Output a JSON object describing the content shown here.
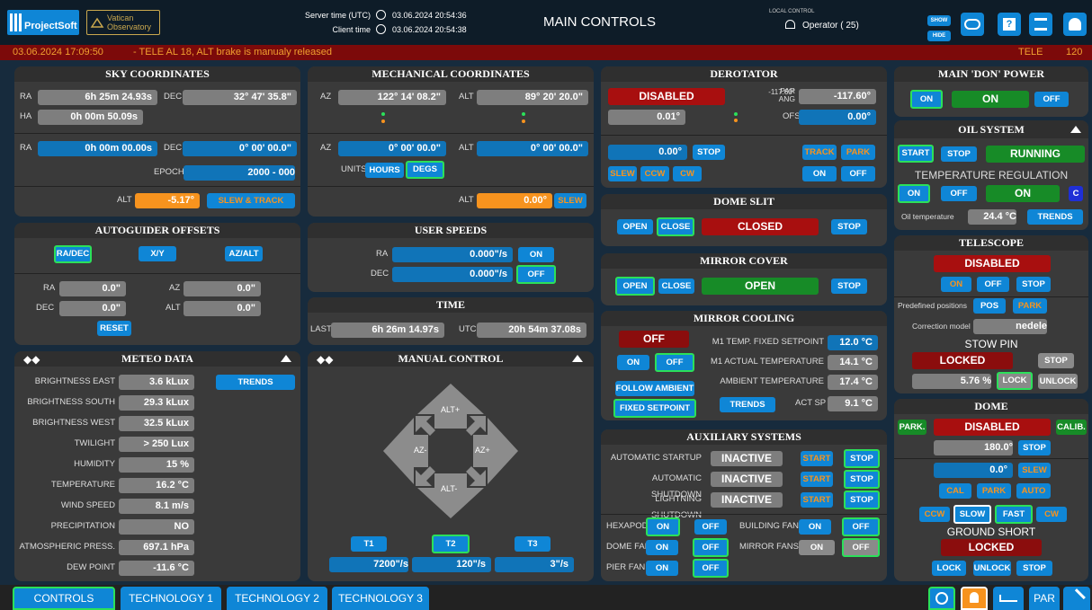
{
  "header": {
    "logo": "ProjectSoft",
    "observatory": "Vatican\nObservatory",
    "server_label": "Server time (UTC)",
    "server_time": "03.06.2024 20:54:36",
    "client_label": "Client time",
    "client_time": "03.06.2024 20:54:38",
    "title": "MAIN CONTROLS",
    "local_control": "LOCAL CONTROL",
    "operator": "Operator ( 25)",
    "show": "SHOW",
    "hide": "HIDE"
  },
  "alarm": {
    "time": "03.06.2024 17:09:50",
    "message": "-  TELE AL 18, ALT brake is manualy released",
    "source": "TELE",
    "code": "120"
  },
  "sky": {
    "title": "SKY COORDINATES",
    "ra_label": "RA",
    "ra": "6h  25m  24.93s",
    "dec_label": "DEC",
    "dec": "32°  47'  35.8\"",
    "ha_label": "HA",
    "ha": "0h  00m  50.09s",
    "ra2": "0h  00m  00.00s",
    "dec2": "0°  00'  00.0\"",
    "epoch_label": "EPOCH",
    "epoch": "2000 - 000",
    "alt_label": "ALT",
    "alt": "-5.17°",
    "slew_track": "SLEW & TRACK"
  },
  "mech": {
    "title": "MECHANICAL COORDINATES",
    "az_label": "AZ",
    "az": "122°  14'  08.2\"",
    "alt_label": "ALT",
    "alt": "89°  20'  20.0\"",
    "az2": "0°  00'  00.0\"",
    "alt2": "0°  00'  00.0\"",
    "units_label": "UNITS",
    "hours": "HOURS",
    "degs": "DEGS",
    "alt3": "0.00°",
    "slew": "SLEW"
  },
  "derotator": {
    "title": "DEROTATOR",
    "status": "DISABLED",
    "par_ang_label": "PAR\nANG",
    "par_ang": "-117.60°",
    "value": "0.01°",
    "ofs_label": "OFS",
    "ofs": "0.00°",
    "target": "0.00°",
    "stop": "STOP",
    "track": "TRACK",
    "park": "PARK",
    "slew": "SLEW",
    "ccw": "CCW",
    "cw": "CW",
    "on": "ON",
    "off": "OFF"
  },
  "don_power": {
    "title": "MAIN 'DON' POWER",
    "on": "ON",
    "status": "ON",
    "off": "OFF"
  },
  "oil": {
    "title": "OIL SYSTEM",
    "start": "START",
    "stop": "STOP",
    "status": "RUNNING",
    "temp_reg_title": "TEMPERATURE REGULATION",
    "on": "ON",
    "off": "OFF",
    "temp_status": "ON",
    "c": "C",
    "oil_temp_label": "Oil temperature",
    "oil_temp": "24.4 °C",
    "trends": "TRENDS"
  },
  "telescope": {
    "title": "TELESCOPE",
    "status": "DISABLED",
    "on": "ON",
    "off": "OFF",
    "stop": "STOP",
    "predef_label": "Predefined positions",
    "pos": "POS",
    "park": "PARK",
    "corr_label": "Correction model",
    "corr": "nedele",
    "stow_title": "STOW PIN",
    "stow_status": "LOCKED",
    "stow_stop": "STOP",
    "stow_pct": "5.76 %",
    "lock": "LOCK",
    "unlock": "UNLOCK"
  },
  "dome": {
    "title": "DOME",
    "park": "PARK.",
    "status": "DISABLED",
    "calib": "CALIB.",
    "pos": "180.0°",
    "stop": "STOP",
    "target": "0.0°",
    "slew": "SLEW",
    "cal": "CAL",
    "park2": "PARK",
    "auto": "AUTO",
    "ccw": "CCW",
    "slow": "SLOW",
    "fast": "FAST",
    "cw": "CW",
    "ground_title": "GROUND SHORT",
    "ground_status": "LOCKED",
    "lock": "LOCK",
    "unlock": "UNLOCK",
    "stop2": "STOP"
  },
  "autoguider": {
    "title": "AUTOGUIDER OFFSETS",
    "radec": "RA/DEC",
    "xy": "X/Y",
    "azalt": "AZ/ALT",
    "ra_label": "RA",
    "ra": "0.0\"",
    "az_label": "AZ",
    "az": "0.0\"",
    "dec_label": "DEC",
    "dec": "0.0\"",
    "alt_label": "ALT",
    "alt": "0.0\"",
    "reset": "RESET"
  },
  "user_speeds": {
    "title": "USER SPEEDS",
    "ra_label": "RA",
    "ra": "0.000\"/s",
    "on": "ON",
    "dec_label": "DEC",
    "dec": "0.000\"/s",
    "off": "OFF"
  },
  "time": {
    "title": "TIME",
    "last_label": "LAST",
    "last": "6h  26m  14.97s",
    "utc_label": "UTC",
    "utc": "20h  54m  37.08s"
  },
  "dome_slit": {
    "title": "DOME SLIT",
    "open": "OPEN",
    "close": "CLOSE",
    "status": "CLOSED",
    "stop": "STOP"
  },
  "mirror_cover": {
    "title": "MIRROR COVER",
    "open": "OPEN",
    "close": "CLOSE",
    "status": "OPEN",
    "stop": "STOP"
  },
  "mirror_cooling": {
    "title": "MIRROR COOLING",
    "status": "OFF",
    "on": "ON",
    "off": "OFF",
    "follow": "FOLLOW AMBIENT",
    "fixed": "FIXED SETPOINT",
    "fixed_sp_label": "M1 TEMP. FIXED SETPOINT",
    "fixed_sp": "12.0 °C",
    "actual_label": "M1 ACTUAL TEMPERATURE",
    "actual": "14.1 °C",
    "ambient_label": "AMBIENT TEMPERATURE",
    "ambient": "17.4 °C",
    "trends": "TRENDS",
    "act_sp_label": "ACT SP",
    "act_sp": "9.1 °C"
  },
  "meteo": {
    "title": "METEO DATA",
    "trends": "TRENDS",
    "rows": [
      {
        "label": "BRIGHTNESS EAST",
        "value": "3.6 kLux"
      },
      {
        "label": "BRIGHTNESS SOUTH",
        "value": "29.3 kLux"
      },
      {
        "label": "BRIGHTNESS WEST",
        "value": "32.5 kLux"
      },
      {
        "label": "TWILIGHT",
        "value": "> 250 Lux"
      },
      {
        "label": "HUMIDITY",
        "value": "15 %"
      },
      {
        "label": "TEMPERATURE",
        "value": "16.2 °C"
      },
      {
        "label": "WIND SPEED",
        "value": "8.1 m/s"
      },
      {
        "label": "PRECIPITATION",
        "value": "NO"
      },
      {
        "label": "ATMOSPHERIC PRESS.",
        "value": "697.1 hPa"
      },
      {
        "label": "DEW POINT",
        "value": "-11.6 °C"
      }
    ]
  },
  "manual": {
    "title": "MANUAL CONTROL",
    "altp": "ALT+",
    "altm": "ALT-",
    "azm": "AZ-",
    "azp": "AZ+",
    "t1": "T1",
    "t2": "T2",
    "t3": "T3",
    "s1": "7200\"/s",
    "s2": "120\"/s",
    "s3": "3\"/s"
  },
  "aux": {
    "title": "AUXILIARY SYSTEMS",
    "auto_start_label": "AUTOMATIC STARTUP",
    "auto_start": "INACTIVE",
    "auto_shut_label": "AUTOMATIC SHUTDOWN",
    "auto_shut": "INACTIVE",
    "light_label": "LIGHTNING SHUTDOWN",
    "light": "INACTIVE",
    "start": "START",
    "stop": "STOP",
    "hexapod_label": "HEXAPOD",
    "building_fan_label": "BUILDING FAN",
    "dome_fan_label": "DOME FAN",
    "mirror_fans_label": "MIRROR FANS",
    "pier_fan_label": "PIER FAN",
    "on": "ON",
    "off": "OFF"
  },
  "tabs": {
    "controls": "CONTROLS",
    "tech1": "TECHNOLOGY 1",
    "tech2": "TECHNOLOGY 2",
    "tech3": "TECHNOLOGY 3",
    "par": "PAR"
  }
}
